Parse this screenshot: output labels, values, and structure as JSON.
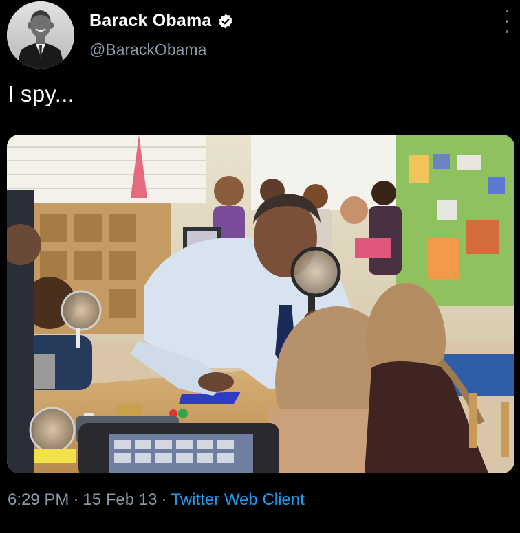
{
  "author": {
    "display_name": "Barack Obama",
    "handle": "@BarackObama",
    "verified": true,
    "avatar_icon": "profile-photo",
    "verified_icon": "verified-badge-icon"
  },
  "tweet": {
    "text": "I spy...",
    "time": "6:29 PM",
    "date": "15 Feb 13",
    "separator": "·",
    "client": "Twitter Web Client"
  },
  "menu": {
    "icon": "more-vertical-icon"
  },
  "colors": {
    "background": "#000000",
    "name_text": "#ffffff",
    "secondary_text": "#8b98a5",
    "link": "#1d9bf0",
    "verified_badge": "#ffffff"
  }
}
